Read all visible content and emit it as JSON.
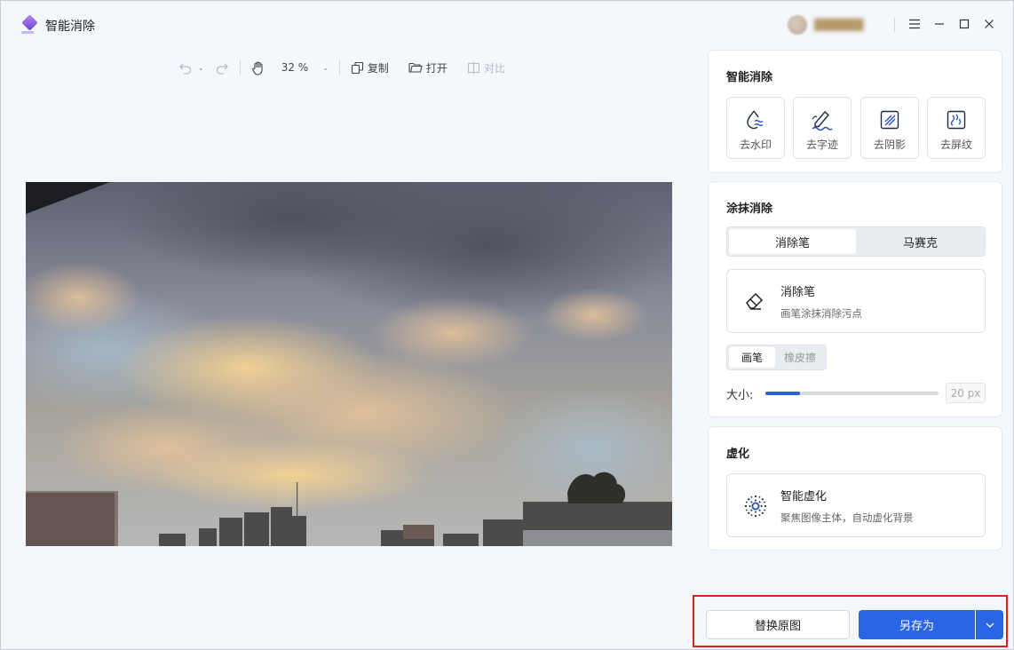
{
  "app": {
    "title": "智能消除"
  },
  "window_controls": {
    "menu": "≡",
    "minimize": "–",
    "maximize": "☐",
    "close": "✕"
  },
  "toolbar": {
    "zoom": "32 %",
    "copy_label": "复制",
    "open_label": "打开",
    "compare_label": "对比"
  },
  "smart_remove": {
    "title": "智能消除",
    "tiles": [
      {
        "label": "去水印",
        "icon": "watermark-drop-icon"
      },
      {
        "label": "去字迹",
        "icon": "handwriting-pen-icon"
      },
      {
        "label": "去阴影",
        "icon": "shadow-square-icon"
      },
      {
        "label": "去屏纹",
        "icon": "moire-screen-icon"
      }
    ]
  },
  "brush_remove": {
    "title": "涂抹消除",
    "tabs": [
      "消除笔",
      "马赛克"
    ],
    "active_tab": 0,
    "feature": {
      "name": "消除笔",
      "desc": "画笔涂抹消除污点",
      "icon": "eraser-icon"
    },
    "mode_tabs": [
      "画笔",
      "橡皮擦"
    ],
    "size_label": "大小:",
    "size_value": "20 px",
    "size_fraction": 0.2
  },
  "blur": {
    "title": "虚化",
    "feature": {
      "name": "智能虚化",
      "desc": "聚焦图像主体，自动虚化背景",
      "icon": "dotted-circle-focus-icon"
    }
  },
  "actions": {
    "replace_label": "替换原图",
    "save_as_label": "另存为"
  },
  "colors": {
    "accent": "#2a66e4",
    "highlight": "#d9221c",
    "icon_blue": "#1f4fbf"
  }
}
